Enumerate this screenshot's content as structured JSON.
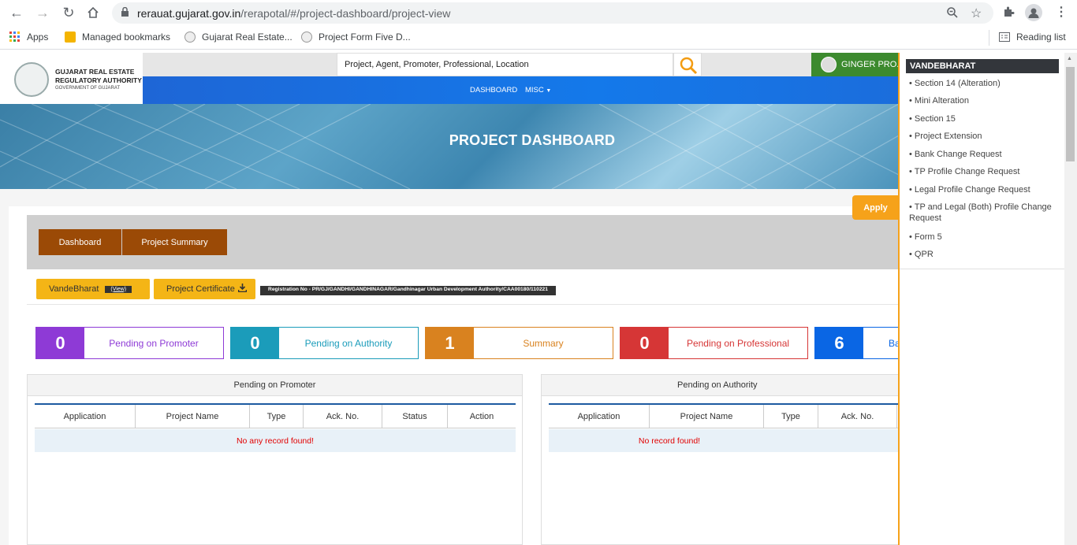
{
  "browser": {
    "url_host": "rerauat.gujarat.gov.in",
    "url_path": "/rerapotal/#/project-dashboard/project-view",
    "bookmarks": [
      "Apps",
      "Managed bookmarks",
      "Gujarat Real Estate...",
      "Project Form Five D..."
    ],
    "reading_list": "Reading list"
  },
  "header": {
    "logo_line1": "GUJARAT REAL ESTATE",
    "logo_line2": "REGULATORY AUTHORITY",
    "logo_line3": "GOVERNMENT OF GUJARAT",
    "search_placeholder": "Project, Agent, Promoter, Professional, Location",
    "user_name": "GINGER PRO...",
    "nav": {
      "dashboard": "DASHBOARD",
      "misc": "MISC"
    }
  },
  "banner": {
    "title": "PROJECT DASHBOARD"
  },
  "tabs": {
    "dashboard": "Dashboard",
    "project_summary": "Project Summary"
  },
  "apply_label": "Apply",
  "actions": {
    "vandebharat": "VandeBharat",
    "view": "(View)",
    "certificate": "Project Certificate",
    "registration": "Registration No - PR/GJ/GANDHI/GANDHINAGAR/Gandhinagar Urban Development Authority/CAA00180/110221"
  },
  "stats": [
    {
      "count": "0",
      "label": "Pending on Promoter",
      "color": "#8e3ad6"
    },
    {
      "count": "0",
      "label": "Pending on Authority",
      "color": "#1b9cba"
    },
    {
      "count": "1",
      "label": "Summary",
      "color": "#d9821f"
    },
    {
      "count": "0",
      "label": "Pending on Professional",
      "color": "#d63636"
    },
    {
      "count": "6",
      "label": "Ba",
      "color": "#0a66e4"
    }
  ],
  "panels": [
    {
      "title": "Pending on Promoter",
      "columns": [
        "Application",
        "Project Name",
        "Type",
        "Ack. No.",
        "Status",
        "Action"
      ],
      "empty": "No any record found!"
    },
    {
      "title": "Pending on Authority",
      "columns": [
        "Application",
        "Project Name",
        "Type",
        "Ack. No."
      ],
      "empty": "No record found!"
    }
  ],
  "dropdown": {
    "title": "VANDEBHARAT",
    "items": [
      "Section 14 (Alteration)",
      "Mini Alteration",
      "Section 15",
      "Project Extension",
      "Bank Change Request",
      "TP Profile Change Request",
      "Legal Profile Change Request",
      "TP and Legal (Both) Profile Change Request",
      "Form 5",
      "QPR"
    ]
  }
}
